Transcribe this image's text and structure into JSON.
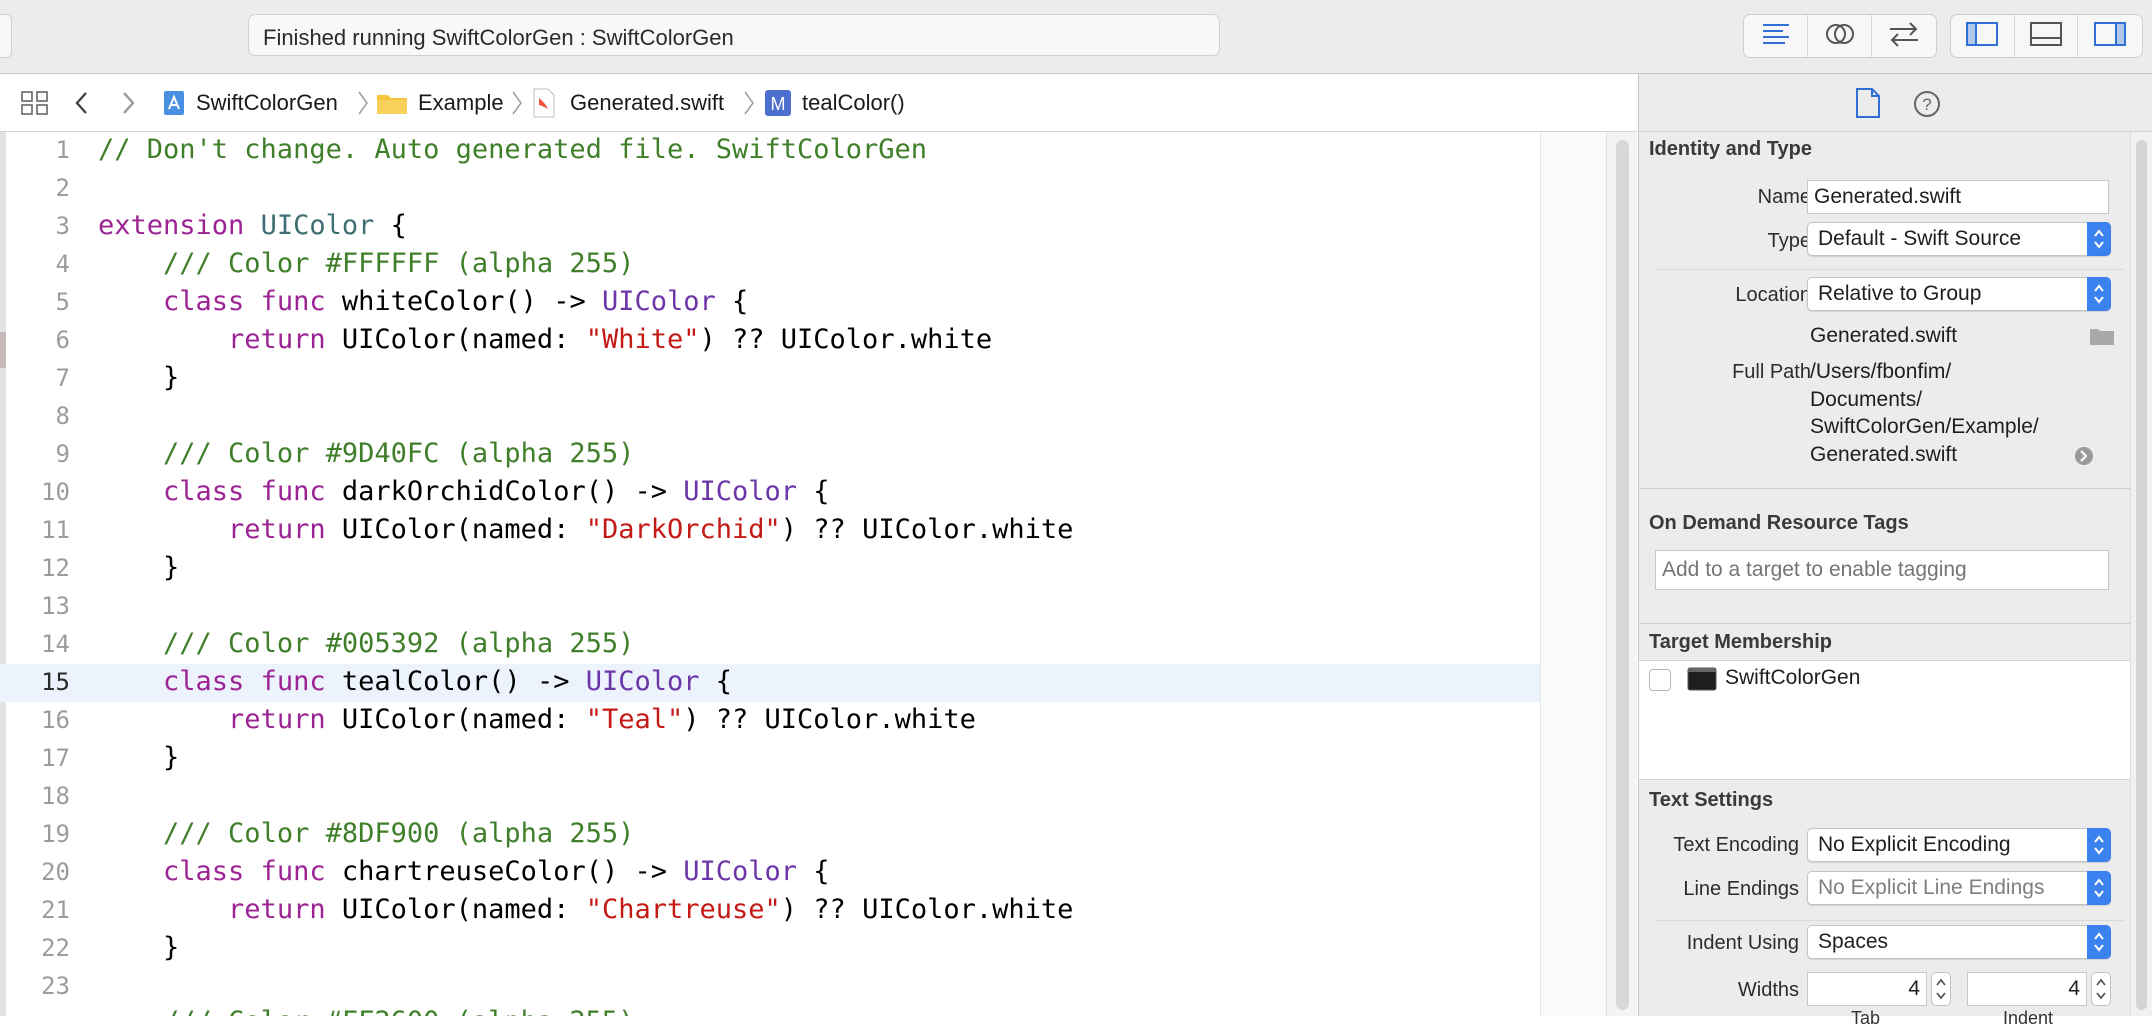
{
  "toolbar": {
    "status": "Finished running SwiftColorGen : SwiftColorGen"
  },
  "jumpbar": {
    "crumbs": [
      "SwiftColorGen",
      "Example",
      "Generated.swift",
      "tealColor()"
    ]
  },
  "editor": {
    "current_line": 15,
    "lines": {
      "l1": "1",
      "l2": "2",
      "l3": "3",
      "l4": "4",
      "l5": "5",
      "l6": "6",
      "l7": "7",
      "l8": "8",
      "l9": "9",
      "l10": "10",
      "l11": "11",
      "l12": "12",
      "l13": "13",
      "l14": "14",
      "l15": "15",
      "l16": "16",
      "l17": "17",
      "l18": "18",
      "l19": "19",
      "l20": "20",
      "l21": "21",
      "l22": "22",
      "l23": "23"
    },
    "code": {
      "header_comment": "// Don't change. Auto generated file. SwiftColorGen",
      "kw_extension": "extension",
      "type_uicolor": "UIColor",
      "open_brace": " {",
      "close_brace": "}",
      "kw_class": "class",
      "kw_func": "func",
      "kw_return": "return",
      "arrow": " -> ",
      "nil_coalesce": ") ?? ",
      "ctor_prefix": "UIColor(named: ",
      "white_member": "UIColor.white",
      "blocks": [
        {
          "comment": "/// Color #FFFFFF (alpha 255)",
          "func": "whiteColor()",
          "name": "\"White\""
        },
        {
          "comment": "/// Color #9D40FC (alpha 255)",
          "func": "darkOrchidColor()",
          "name": "\"DarkOrchid\""
        },
        {
          "comment": "/// Color #005392 (alpha 255)",
          "func": "tealColor()",
          "name": "\"Teal\""
        },
        {
          "comment": "/// Color #8DF900 (alpha 255)",
          "func": "chartreuseColor()",
          "name": "\"Chartreuse\""
        }
      ]
    }
  },
  "inspector": {
    "identity": {
      "title": "Identity and Type",
      "name_label": "Name",
      "name_value": "Generated.swift",
      "type_label": "Type",
      "type_value": "Default - Swift Source",
      "location_label": "Location",
      "location_value": "Relative to Group",
      "location_file": "Generated.swift",
      "fullpath_label": "Full Path",
      "fullpath_lines": [
        "/Users/fbonfim/",
        "Documents/",
        "SwiftColorGen/Example/",
        "Generated.swift"
      ]
    },
    "tags": {
      "title": "On Demand Resource Tags",
      "placeholder": "Add to a target to enable tagging"
    },
    "membership": {
      "title": "Target Membership",
      "target": "SwiftColorGen",
      "checked": false
    },
    "text_settings": {
      "title": "Text Settings",
      "encoding_label": "Text Encoding",
      "encoding_value": "No Explicit Encoding",
      "endings_label": "Line Endings",
      "endings_value": "No Explicit Line Endings",
      "indent_label": "Indent Using",
      "indent_value": "Spaces",
      "widths_label": "Widths",
      "tab_value": "4",
      "indent_width_value": "4",
      "tab_caption": "Tab",
      "indent_caption": "Indent"
    }
  },
  "colors": {
    "accent": "#3b82f0",
    "keyword": "#9b2393",
    "comment": "#3f7f2a",
    "string": "#c41a16",
    "class_name": "#6c36a9"
  }
}
